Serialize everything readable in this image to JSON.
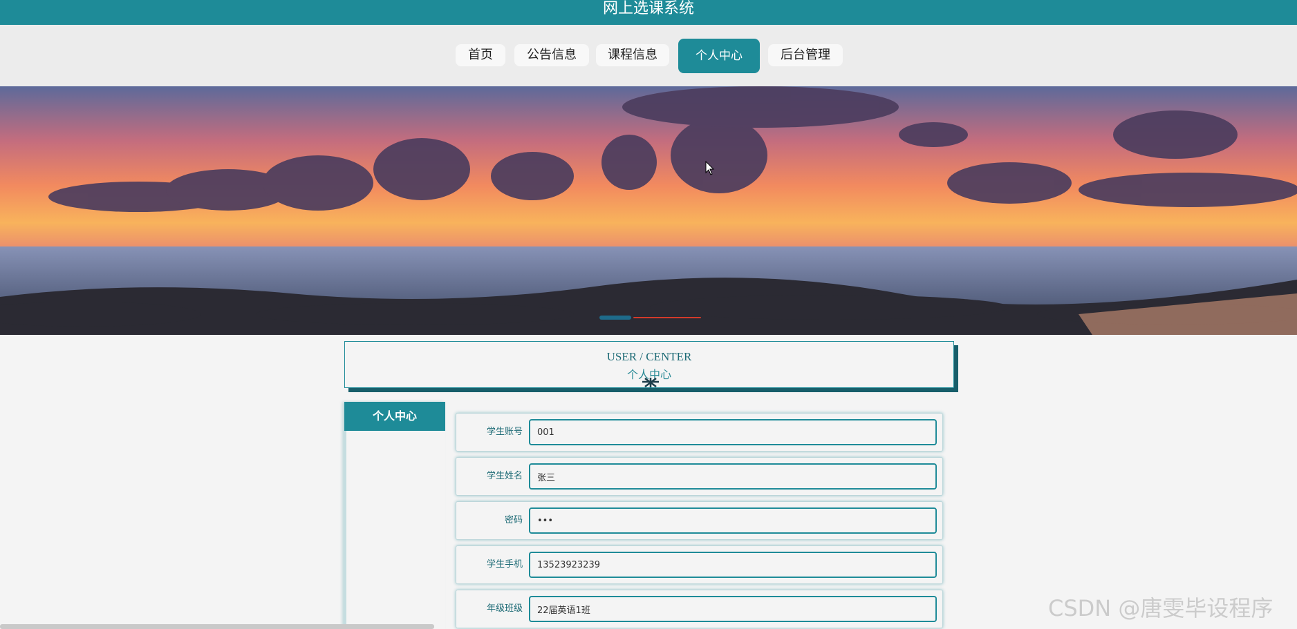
{
  "app": {
    "title": "网上选课系统"
  },
  "nav": {
    "items": [
      {
        "label": "首页"
      },
      {
        "label": "公告信息"
      },
      {
        "label": "课程信息"
      },
      {
        "label": "个人中心",
        "active": true
      },
      {
        "label": "后台管理"
      }
    ]
  },
  "banner": {
    "slide_count": 2,
    "active_slide": 1
  },
  "section": {
    "title_en": "USER / CENTER",
    "title_cn": "个人中心"
  },
  "sidebar": {
    "heading": "个人中心"
  },
  "form": {
    "fields": [
      {
        "label": "学生账号",
        "value": "001"
      },
      {
        "label": "学生姓名",
        "value": "张三"
      },
      {
        "label": "密码",
        "value": "•••"
      },
      {
        "label": "学生手机",
        "value": "13523923239"
      },
      {
        "label": "年级班级",
        "value": "22届英语1班"
      }
    ]
  },
  "watermark": "CSDN @唐雯毕设程序",
  "colors": {
    "primary": "#1e8b98",
    "primary_dark": "#175e6a",
    "background": "#f4f4f4"
  }
}
